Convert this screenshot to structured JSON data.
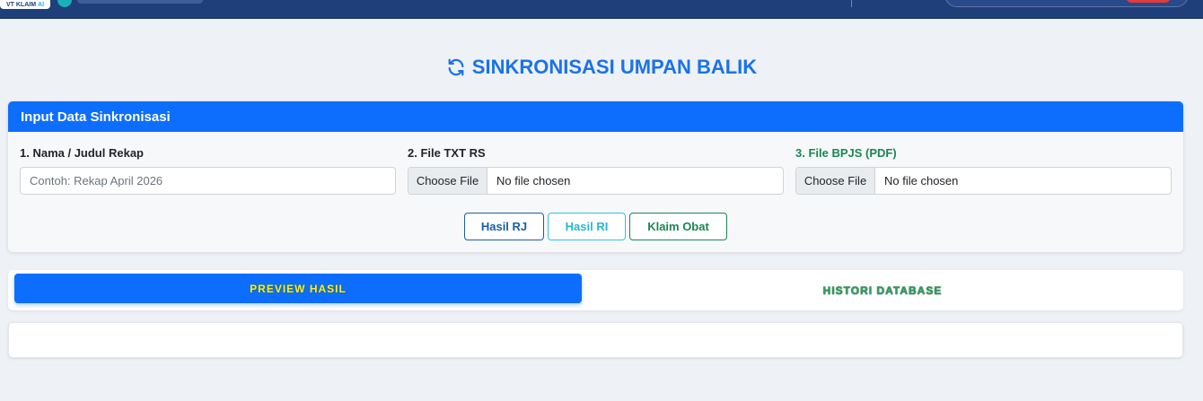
{
  "header": {
    "brand_badge_text": "VT KLAIM",
    "brand_badge_suffix": "AI"
  },
  "page": {
    "title": "SINKRONISASI UMPAN BALIK",
    "title_icon": "sync-icon",
    "accent_color": "#1a73e8"
  },
  "form": {
    "header": "Input Data Sinkronisasi",
    "header_color": "#0d6efd",
    "fields": {
      "name_label": "1. Nama / Judul Rekap",
      "name_placeholder": "Contoh: Rekap April 2026",
      "txt_label": "2. File TXT RS",
      "txt_button": "Choose File",
      "txt_status": "No file chosen",
      "bpjs_label": "3. File BPJS (PDF)",
      "bpjs_button": "Choose File",
      "bpjs_status": "No file chosen"
    },
    "buttons": {
      "rj": "Hasil RJ",
      "ri": "Hasil RI",
      "obat": "Klaim Obat"
    }
  },
  "tabs": {
    "preview": "PREVIEW HASIL",
    "histori": "HISTORI DATABASE",
    "active": "preview"
  }
}
